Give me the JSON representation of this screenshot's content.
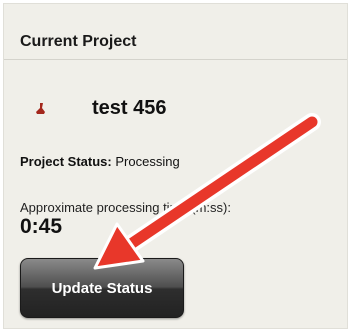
{
  "panel": {
    "title": "Current Project"
  },
  "project": {
    "icon": "project-pin-icon",
    "name": "test 456"
  },
  "status": {
    "label": "Project Status:",
    "value": "Processing"
  },
  "processing_time": {
    "label": "Approximate processing time (m:ss):",
    "value": "0:45"
  },
  "actions": {
    "update_label": "Update Status"
  },
  "colors": {
    "arrow": "#e8372a",
    "icon": "#a3271c",
    "button_dark": "#2e2e2e"
  }
}
